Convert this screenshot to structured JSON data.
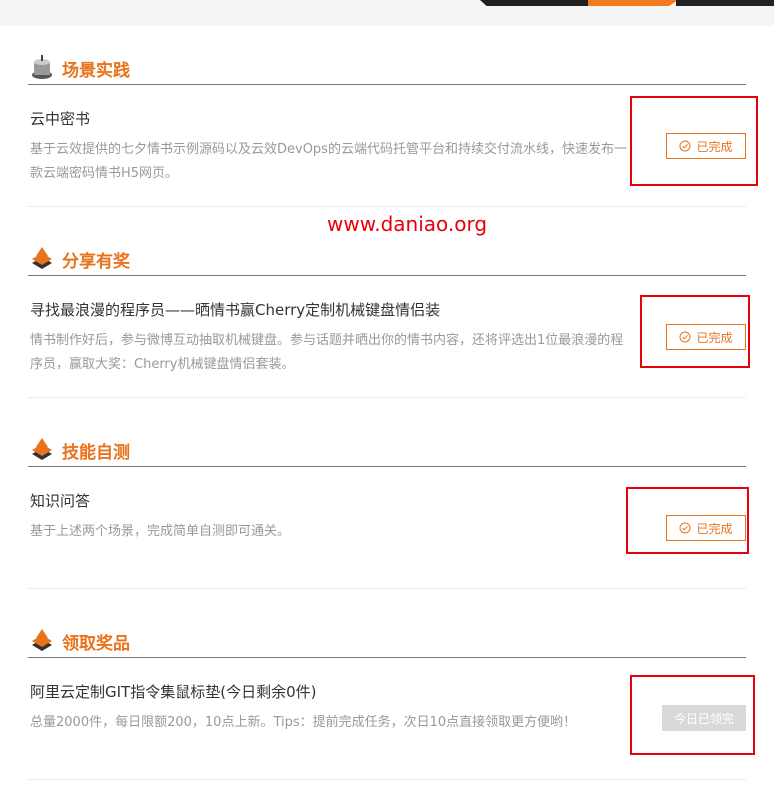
{
  "sections": [
    {
      "title": "场景实践",
      "task": {
        "title": "云中密书",
        "desc": "基于云效提供的七夕情书示例源码以及云效DevOps的云端代码托管平台和持续交付流水线，快速发布一款云端密码情书H5网页。",
        "button": "已完成"
      }
    },
    {
      "title": "分享有奖",
      "task": {
        "title": "寻找最浪漫的程序员——晒情书赢Cherry定制机械键盘情侣装",
        "desc": "情书制作好后，参与微博互动抽取机械键盘。参与话题并晒出你的情书内容，还将评选出1位最浪漫的程序员，赢取大奖：Cherry机械键盘情侣套装。",
        "button": "已完成"
      }
    },
    {
      "title": "技能自测",
      "task": {
        "title": "知识问答",
        "desc": "基于上述两个场景，完成简单自测即可通关。",
        "button": "已完成"
      }
    },
    {
      "title": "领取奖品",
      "task": {
        "title": "阿里云定制GIT指令集鼠标垫(今日剩余0件)",
        "desc": "总量2000件，每日限额200，10点上新。Tips：提前完成任务，次日10点直接领取更方便哟！",
        "button": "今日已领完"
      }
    }
  ],
  "watermark": "www.daniao.org",
  "colors": {
    "accent": "#e8731c",
    "annotation": "#e8000b",
    "disabled": "#d9d9d9"
  },
  "icons": {
    "section": "cake-layers-icon",
    "done": "check-circle-icon"
  }
}
